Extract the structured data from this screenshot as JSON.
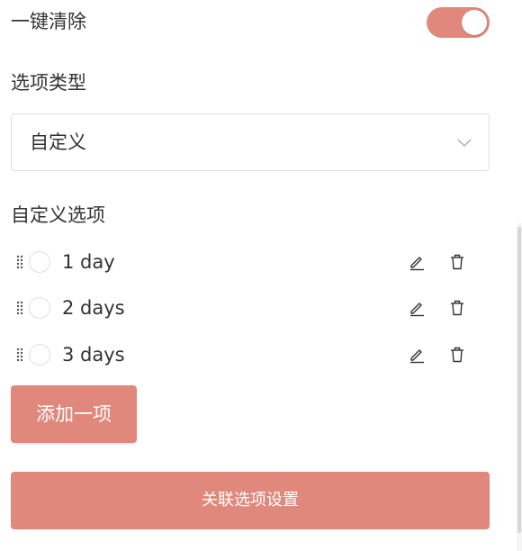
{
  "clear_all": {
    "label": "一键清除",
    "enabled": true
  },
  "option_type": {
    "label": "选项类型",
    "selected": "自定义"
  },
  "custom_options": {
    "label": "自定义选项",
    "items": [
      {
        "label": "1 day"
      },
      {
        "label": "2 days"
      },
      {
        "label": "3 days"
      }
    ]
  },
  "buttons": {
    "add_label": "添加一项",
    "link_label": "关联选项设置"
  },
  "icons": {
    "drag": "drag-handle-icon",
    "edit": "edit-pencil-icon",
    "delete": "trash-icon",
    "chevron": "chevron-down-icon"
  },
  "colors": {
    "accent": "#e0887c",
    "text": "#333333",
    "border": "#dcdfe6"
  }
}
